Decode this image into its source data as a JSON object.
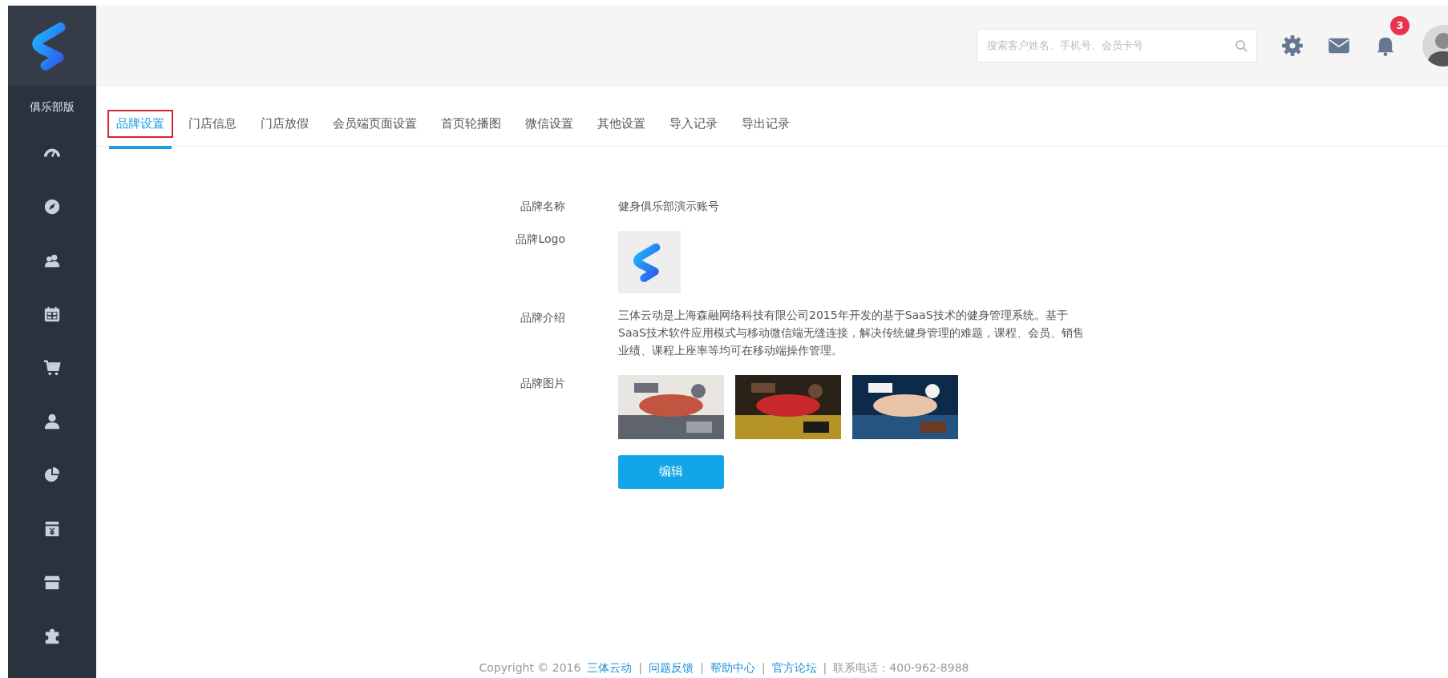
{
  "sidebar": {
    "edition": "俱乐部版"
  },
  "header": {
    "search": {
      "placeholder": "搜索客户姓名、手机号、会员卡号"
    },
    "notifications": {
      "count": "3"
    }
  },
  "tabs": [
    {
      "label": "品牌设置",
      "selected": true
    },
    {
      "label": "门店信息",
      "selected": false
    },
    {
      "label": "门店放假",
      "selected": false
    },
    {
      "label": "会员端页面设置",
      "selected": false
    },
    {
      "label": "首页轮播图",
      "selected": false
    },
    {
      "label": "微信设置",
      "selected": false
    },
    {
      "label": "其他设置",
      "selected": false
    },
    {
      "label": "导入记录",
      "selected": false
    },
    {
      "label": "导出记录",
      "selected": false
    }
  ],
  "form": {
    "fields": [
      {
        "kind": "text",
        "label": "品牌名称",
        "value": "健身俱乐部演示账号"
      },
      {
        "kind": "logo",
        "label": "品牌Logo"
      },
      {
        "kind": "paragraph",
        "label": "品牌介绍",
        "value": "三体云动是上海森融网络科技有限公司2015年开发的基于SaaS技术的健身管理系统。基于SaaS技术软件应用模式与移动微信端无缝连接，解决传统健身管理的难题，课程、会员、销售业绩、课程上座率等均可在移动端操作管理。"
      },
      {
        "kind": "pictures",
        "label": "品牌图片"
      }
    ],
    "button": "编辑"
  },
  "footer": [
    {
      "kind": "text",
      "text": "Copyright © 2016"
    },
    {
      "kind": "link",
      "text": "三体云动"
    },
    {
      "kind": "sep",
      "text": "|"
    },
    {
      "kind": "link",
      "text": "问题反馈"
    },
    {
      "kind": "sep",
      "text": "|"
    },
    {
      "kind": "link",
      "text": "帮助中心"
    },
    {
      "kind": "sep",
      "text": "|"
    },
    {
      "kind": "link",
      "text": "官方论坛"
    },
    {
      "kind": "sep",
      "text": "|"
    },
    {
      "kind": "text",
      "text": "联系电话：400-962-8988"
    }
  ]
}
